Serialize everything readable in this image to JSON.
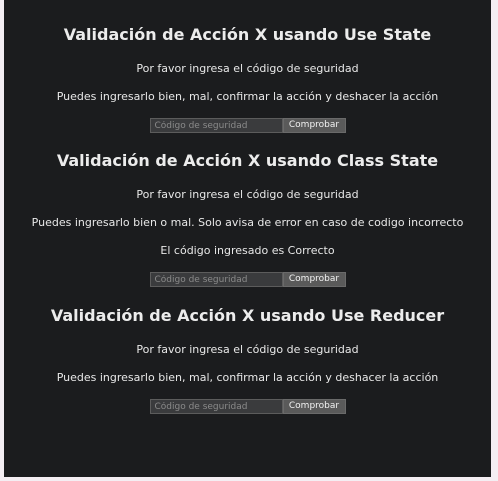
{
  "sections": [
    {
      "title": "Validación de Acción X usando Use State",
      "prompt": "Por favor ingresa el código de seguridad",
      "description": "Puedes ingresarlo bien, mal, confirmar la acción y deshacer la acción",
      "input_placeholder": "Código de seguridad",
      "input_value": "",
      "button_label": "Comprobar"
    },
    {
      "title": "Validación de Acción X usando Class State",
      "prompt": "Por favor ingresa el código de seguridad",
      "description": "Puedes ingresarlo bien o mal. Solo avisa de error en caso de codigo incorrecto",
      "status": "El código ingresado es Correcto",
      "input_placeholder": "Código de seguridad",
      "input_value": "",
      "button_label": "Comprobar"
    },
    {
      "title": "Validación de Acción X usando Use Reducer",
      "prompt": "Por favor ingresa el código de seguridad",
      "description": "Puedes ingresarlo bien, mal, confirmar la acción y deshacer la acción",
      "input_placeholder": "Código de seguridad",
      "input_value": "",
      "button_label": "Comprobar"
    }
  ]
}
